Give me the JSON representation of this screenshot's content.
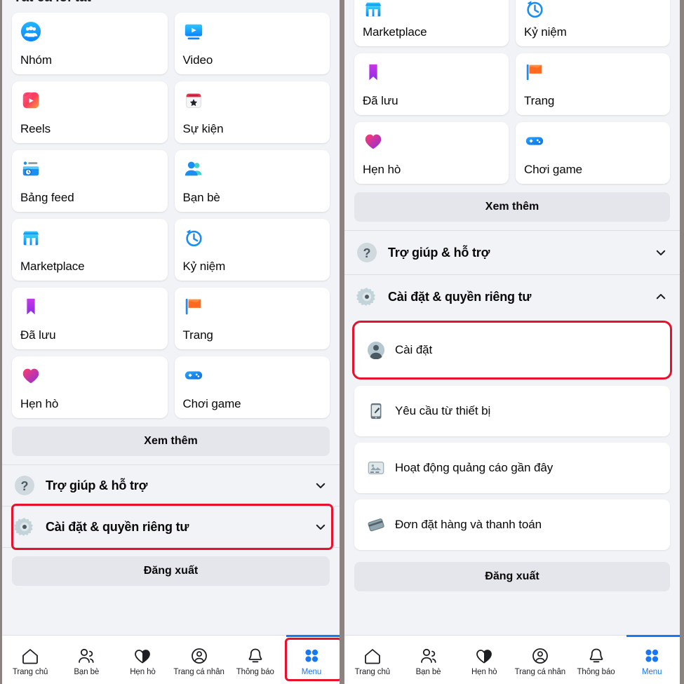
{
  "app": {
    "clipped_header": "Tất cả lối tắt",
    "accent_blue": "#1877f2",
    "highlight_red": "#e8112d",
    "page_bg": "#f2f3f7",
    "card_bg": "#ffffff",
    "button_bg": "#e4e6eb"
  },
  "shortcuts": [
    {
      "label": "Nhóm",
      "icon": "groups-icon"
    },
    {
      "label": "Video",
      "icon": "video-icon"
    },
    {
      "label": "Reels",
      "icon": "reels-icon"
    },
    {
      "label": "Sự kiện",
      "icon": "events-icon"
    },
    {
      "label": "Bảng feed",
      "icon": "feeds-icon"
    },
    {
      "label": "Bạn bè",
      "icon": "friends-icon"
    },
    {
      "label": "Marketplace",
      "icon": "marketplace-icon"
    },
    {
      "label": "Kỷ niệm",
      "icon": "memories-icon"
    },
    {
      "label": "Đã lưu",
      "icon": "saved-icon"
    },
    {
      "label": "Trang",
      "icon": "pages-icon"
    },
    {
      "label": "Hẹn hò",
      "icon": "dating-icon"
    },
    {
      "label": "Chơi game",
      "icon": "gaming-icon"
    }
  ],
  "buttons": {
    "see_more": "Xem thêm",
    "logout": "Đăng xuất"
  },
  "expandables": {
    "help": {
      "label": "Trợ giúp & hỗ trợ",
      "icon": "question-circle-icon",
      "state": "collapsed"
    },
    "settings": {
      "label": "Cài đặt & quyền riêng tư",
      "icon": "gear-icon",
      "state_left": "collapsed",
      "state_right": "expanded"
    }
  },
  "settings_submenu": [
    {
      "label": "Cài đặt",
      "icon": "account-avatar-icon",
      "highlighted": true
    },
    {
      "label": "Yêu cầu từ thiết bị",
      "icon": "device-request-icon",
      "highlighted": false
    },
    {
      "label": "Hoạt động quảng cáo gần đây",
      "icon": "ad-activity-icon",
      "highlighted": false
    },
    {
      "label": "Đơn đặt hàng và thanh toán",
      "icon": "payments-card-icon",
      "highlighted": false
    }
  ],
  "tabbar": [
    {
      "label": "Trang chủ",
      "icon": "home-icon",
      "active": false
    },
    {
      "label": "Bạn bè",
      "icon": "friends-outline-icon",
      "active": false
    },
    {
      "label": "Hẹn hò",
      "icon": "dating-heart-icon",
      "active": false
    },
    {
      "label": "Trang cá nhân",
      "icon": "profile-icon",
      "active": false
    },
    {
      "label": "Thông báo",
      "icon": "bell-icon",
      "active": false
    },
    {
      "label": "Menu",
      "icon": "menu-grid-icon",
      "active": true
    }
  ]
}
